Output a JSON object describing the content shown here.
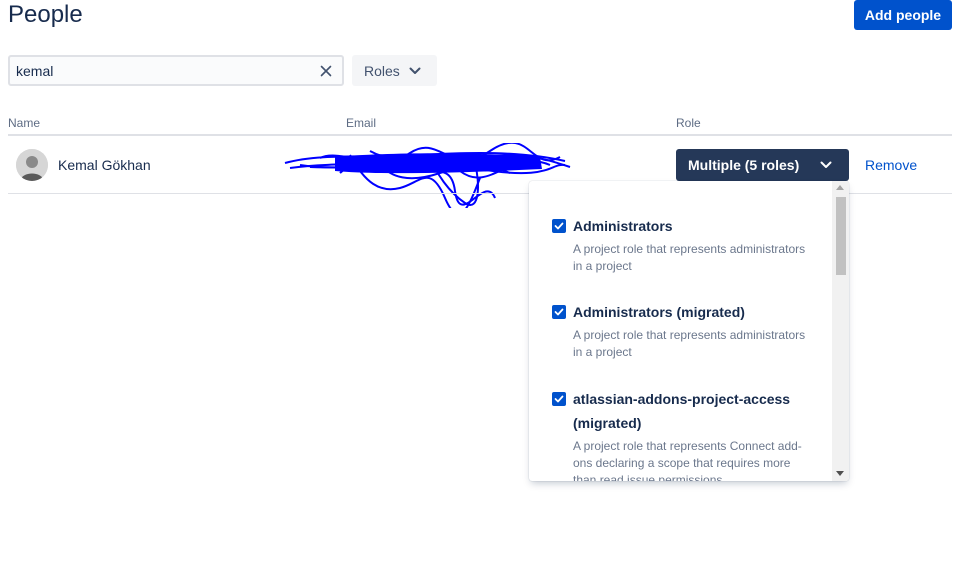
{
  "header": {
    "title": "People",
    "add_button": "Add people"
  },
  "filters": {
    "search_value": "kemal",
    "roles_label": "Roles"
  },
  "table": {
    "columns": {
      "name": "Name",
      "email": "Email",
      "role": "Role"
    },
    "rows": [
      {
        "name": "Kemal Gökhan",
        "role_button": "Multiple (5 roles)",
        "remove": "Remove"
      }
    ]
  },
  "dropdown": {
    "options": [
      {
        "label": "Administrators",
        "checked": true,
        "description": "A project role that represents administrators in a project"
      },
      {
        "label": "Administrators (migrated)",
        "checked": true,
        "description": "A project role that represents administrators in a project"
      },
      {
        "label": "atlassian-addons-project-access (migrated)",
        "checked": true,
        "description": "A project role that represents Connect add-ons declaring a scope that requires more than read issue permissions"
      }
    ]
  },
  "colors": {
    "primary": "#0052cc",
    "dark_button": "#253858",
    "text": "#172b4d",
    "subtle": "#5e6c84",
    "redaction": "#0000ff"
  },
  "icons": {
    "clear": "close-icon",
    "chevron": "chevron-down-icon",
    "check": "check-icon"
  }
}
